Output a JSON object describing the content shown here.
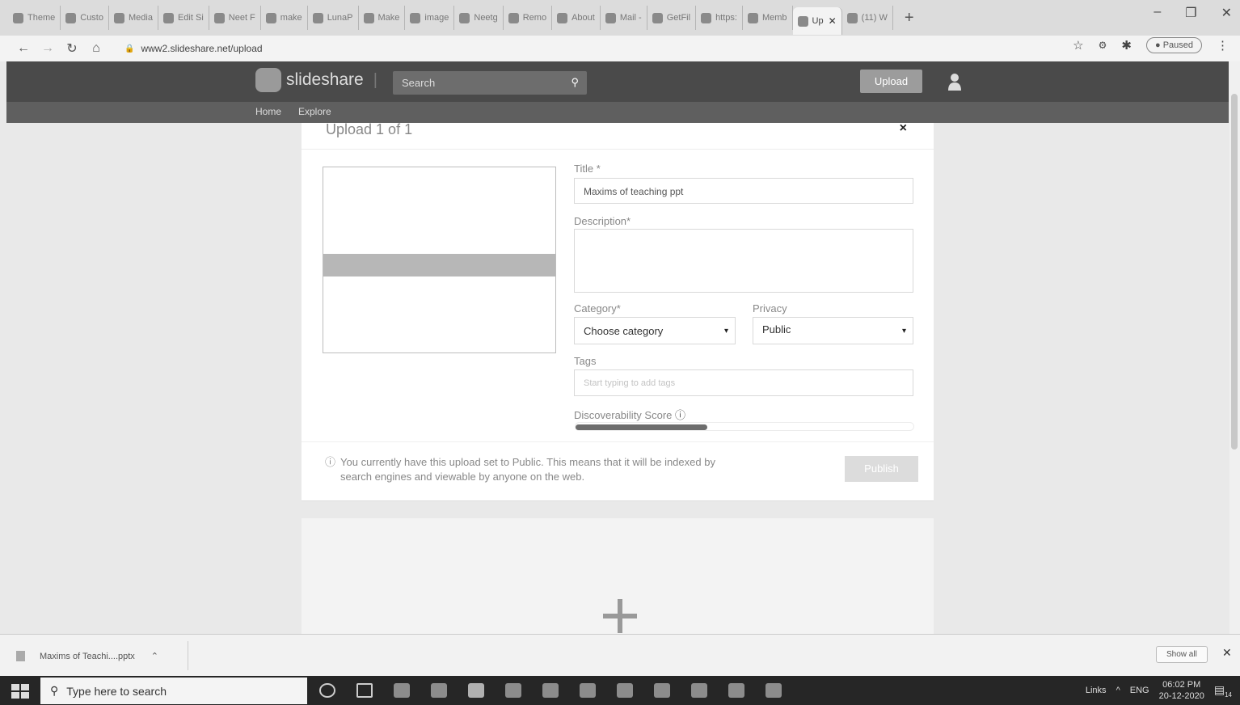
{
  "browser": {
    "tabs": [
      {
        "label": "Theme"
      },
      {
        "label": "Custo"
      },
      {
        "label": "Media"
      },
      {
        "label": "Edit Si"
      },
      {
        "label": "Neet F"
      },
      {
        "label": "make"
      },
      {
        "label": "LunaP"
      },
      {
        "label": "Make"
      },
      {
        "label": "image"
      },
      {
        "label": "Neetg"
      },
      {
        "label": "Remo"
      },
      {
        "label": "About"
      },
      {
        "label": "Mail -"
      },
      {
        "label": "GetFil"
      },
      {
        "label": "https:"
      },
      {
        "label": "Memb"
      },
      {
        "label": "Up",
        "active": true
      },
      {
        "label": "(11) W"
      }
    ],
    "new_tab": "+",
    "url": "www2.slideshare.net/upload",
    "profile_status": "Paused"
  },
  "site": {
    "logo_text": "slideshare",
    "search_placeholder": "Search",
    "upload_button": "Upload",
    "nav": [
      "Home",
      "Explore"
    ]
  },
  "modal": {
    "title": "Upload 1 of 1",
    "close": "×",
    "form": {
      "title_label": "Title *",
      "title_value": "Maxims of teaching ppt",
      "description_label": "Description*",
      "description_value": "",
      "category_label": "Category*",
      "category_value": "Choose category",
      "privacy_label": "Privacy",
      "privacy_value": "Public",
      "tags_label": "Tags",
      "tags_placeholder": "Start typing to add tags",
      "score_label": "Discoverability Score",
      "score_fraction": 0.39
    },
    "notice": "You currently have this upload set to Public. This means that it will be indexed by search engines and viewable by anyone on the web.",
    "publish_button": "Publish"
  },
  "downloads": {
    "file": "Maxims of Teachi....pptx",
    "show_all": "Show all"
  },
  "taskbar": {
    "search_placeholder": "Type here to search",
    "links": "Links",
    "lang": "ENG",
    "time": "06:02 PM",
    "date": "20-12-2020",
    "notif_count": "14"
  }
}
